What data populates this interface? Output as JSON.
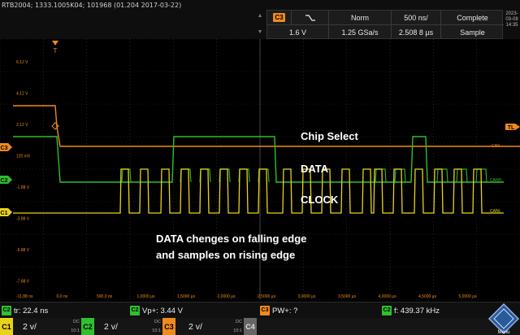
{
  "device": {
    "info": "RTB2004; 1333.1005K04; 101968 (01.204 2017-03-22)"
  },
  "datetime": {
    "date": "2023-03-08",
    "time": "14:35"
  },
  "trigger": {
    "source_badge": "C3",
    "slope_icon": "falling-edge-icon",
    "mode": "Norm",
    "timebase": "500 ns/",
    "status": "Complete",
    "level": "1.6 V",
    "sample_rate": "1.25 GSa/s",
    "record_length": "2.508 8 µs",
    "acquisition": "Sample"
  },
  "screen": {
    "trigger_marker": "T",
    "trigger_level_marker": "TL",
    "y_labels": [
      "6.12 V",
      "4.12 V",
      "2.12 V",
      "120 mV",
      "-1.88 V",
      "-3.88 V",
      "-5.88 V",
      "-7.88 V",
      "-9.88 V"
    ],
    "x_labels": [
      "-11,88 ns",
      "0,0 ns",
      "500,0 ns",
      "1,0000 µs",
      "1,5000 µs",
      "2,0000 µs",
      "2,5000 µs",
      "3,0000 µs",
      "3,5000 µs",
      "4,0000 µs",
      "4,5000 µs",
      "5,0000 µs"
    ],
    "channel_markers": {
      "c3": "C3",
      "c2": "C2",
      "c1": "C1"
    },
    "right_markers": {
      "c3": "CH3",
      "c2": "CANH",
      "c1": "CANL"
    },
    "annotations": {
      "chip_select": "Chip Select",
      "data": "DATA",
      "clock": "CLOCK",
      "note_line1": "DATA chenges on falling edge",
      "note_line2": "and samples on rising edge"
    }
  },
  "measurements": [
    {
      "badge": "C2",
      "text": "tr: 22.4 ns",
      "color": "#2fbf2f"
    },
    {
      "badge": "C2",
      "text": "Vp+: 3.44 V",
      "color": "#2fbf2f"
    },
    {
      "badge": "C3",
      "text": "PW+: ?",
      "color": "#f08a1c"
    },
    {
      "badge": "C2",
      "text": "f: 439.37 kHz",
      "color": "#2fbf2f"
    }
  ],
  "channels": [
    {
      "label": "C1",
      "value": "2 v/",
      "coupling": "DC",
      "probe": "10:1",
      "color": "#e8d31a"
    },
    {
      "label": "C2",
      "value": "2 v/",
      "coupling": "DC",
      "probe": "10:1",
      "color": "#2fbf2f"
    },
    {
      "label": "C3",
      "value": "2 v/",
      "coupling": "DC",
      "probe": "10:1",
      "color": "#f08a1c"
    },
    {
      "label": "C4",
      "value": "",
      "coupling": "",
      "probe": "",
      "color": "#666666"
    }
  ],
  "menu": {
    "label": "Menu"
  },
  "colors": {
    "ch1": "#e8d31a",
    "ch2": "#2fbf2f",
    "ch3": "#f08a1c",
    "grid": "#3a3a3a"
  }
}
